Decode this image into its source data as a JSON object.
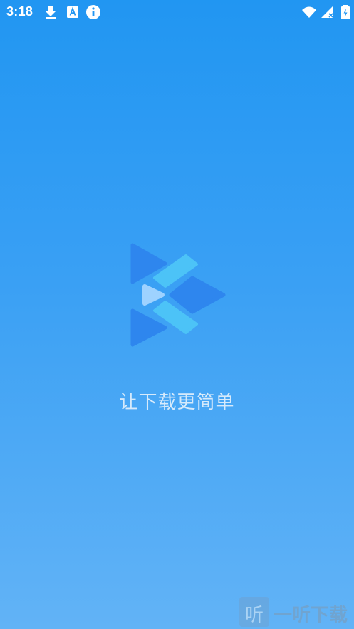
{
  "status_bar": {
    "time": "3:18",
    "icons": [
      "download-icon",
      "font-a-icon",
      "info-icon",
      "wifi-icon",
      "signal-icon",
      "battery-icon"
    ]
  },
  "splash": {
    "tagline": "让下载更简单",
    "logo_icon": "play-logo-icon",
    "colors": {
      "gradient_top": "#2196F2",
      "gradient_bottom": "#62B3F6",
      "logo_triangle": "#2E86EE",
      "logo_bar": "#4CC3F7",
      "logo_play": "#9ED2FF"
    }
  },
  "watermark": {
    "glyph": "听",
    "text": "一听下载"
  }
}
